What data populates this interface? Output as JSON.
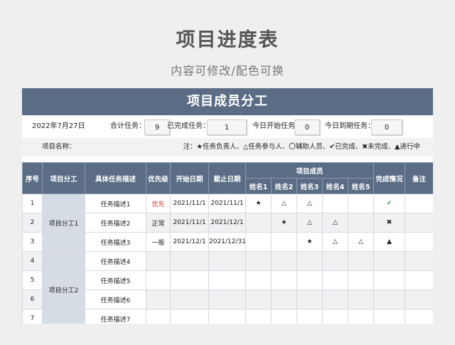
{
  "title": "项目进度表",
  "subtitle": "内容可修改/配色可换",
  "sheet": {
    "header": "项目成员分工",
    "date": "2022年7月27日",
    "total_label": "合计任务：",
    "total_value": "9",
    "done_label": "已完成任务：",
    "done_value": "1",
    "start_today_label": "今日开始任务：",
    "start_today_value": "0",
    "due_today_label": "今日到期任务：",
    "due_today_value": "0",
    "project_name_label": "项目名称：",
    "legend": "注：★任务负责人、△任务参与人、〇辅助人员、✔已完成、✖未完成、▲进行中"
  },
  "table": {
    "headers": {
      "no": "序号",
      "division": "项目分工",
      "task": "具体任务描述",
      "priority": "优先级",
      "start": "开始日期",
      "end": "截止日期",
      "members": "项目成员",
      "status": "完成情况",
      "note": "备注"
    },
    "member_names": [
      "姓名1",
      "姓名2",
      "姓名3",
      "姓名4",
      "姓名5"
    ],
    "groups": [
      "项目分工1",
      "项目分工2"
    ],
    "rows": [
      {
        "no": "1",
        "task": "任务描述1",
        "priority": "优先",
        "start": "2021/11/1",
        "end": "2021/11/1",
        "m": [
          "★",
          "△",
          "△",
          "",
          ""
        ],
        "status": "✔",
        "note": ""
      },
      {
        "no": "2",
        "task": "任务描述2",
        "priority": "正常",
        "start": "2021/11/1",
        "end": "2021/12/1",
        "m": [
          "",
          "★",
          "△",
          "△",
          ""
        ],
        "status": "✖",
        "note": ""
      },
      {
        "no": "3",
        "task": "任务描述3",
        "priority": "一般",
        "start": "2021/12/1",
        "end": "2021/12/31",
        "m": [
          "",
          "",
          "★",
          "△",
          "△"
        ],
        "status": "▲",
        "note": ""
      },
      {
        "no": "4",
        "task": "任务描述4",
        "priority": "",
        "start": "",
        "end": "",
        "m": [
          "",
          "",
          "",
          "",
          ""
        ],
        "status": "",
        "note": ""
      },
      {
        "no": "5",
        "task": "任务描述5",
        "priority": "",
        "start": "",
        "end": "",
        "m": [
          "",
          "",
          "",
          "",
          ""
        ],
        "status": "",
        "note": ""
      },
      {
        "no": "6",
        "task": "任务描述6",
        "priority": "",
        "start": "",
        "end": "",
        "m": [
          "",
          "",
          "",
          "",
          ""
        ],
        "status": "",
        "note": ""
      },
      {
        "no": "7",
        "task": "任务描述7",
        "priority": "",
        "start": "",
        "end": "",
        "m": [
          "",
          "",
          "",
          "",
          ""
        ],
        "status": "",
        "note": ""
      }
    ]
  }
}
